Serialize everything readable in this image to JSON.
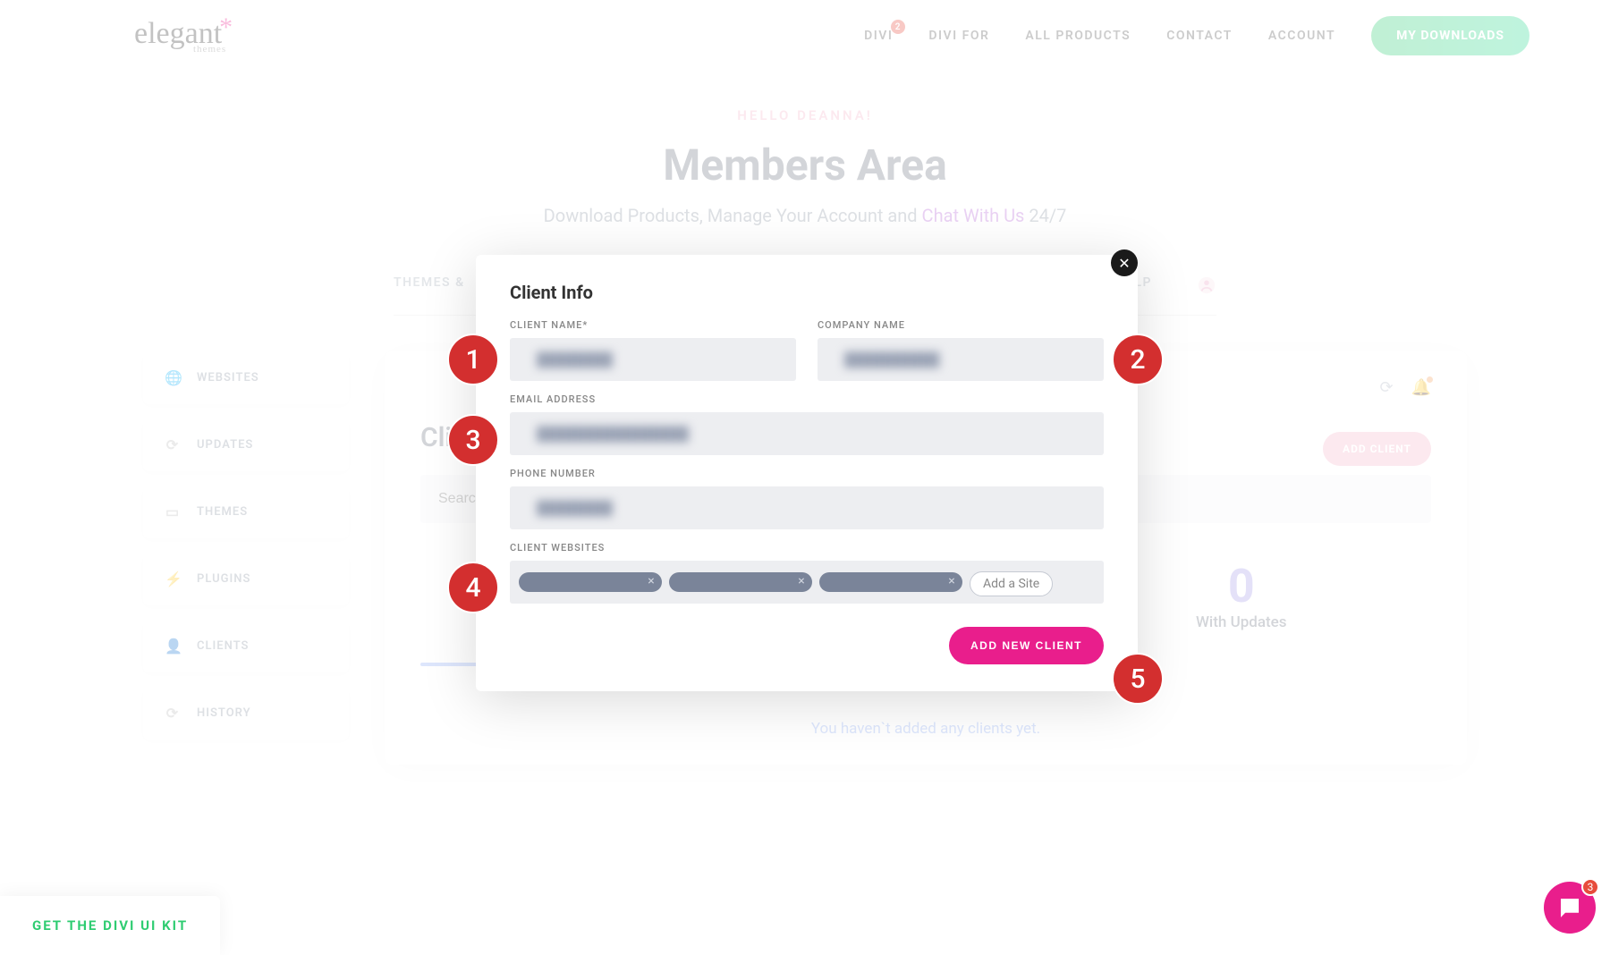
{
  "header": {
    "logo_main": "elegant",
    "logo_sub": "themes",
    "nav": [
      {
        "label": "DIVI",
        "badge": "2"
      },
      {
        "label": "DIVI FOR"
      },
      {
        "label": "ALL PRODUCTS"
      },
      {
        "label": "CONTACT"
      },
      {
        "label": "ACCOUNT"
      }
    ],
    "downloads_btn": "MY DOWNLOADS"
  },
  "hero": {
    "hello": "HELLO DEANNA!",
    "title": "Members Area",
    "subtitle_pre": "Download Products, Manage Your Account and ",
    "subtitle_link": "Chat With Us",
    "subtitle_post": " 24/7"
  },
  "tabs": {
    "themes": "THEMES &",
    "help": "LP"
  },
  "sidebar": {
    "items": [
      {
        "icon": "globe",
        "label": "WEBSITES"
      },
      {
        "icon": "refresh",
        "label": "UPDATES"
      },
      {
        "icon": "card",
        "label": "THEMES"
      },
      {
        "icon": "plug",
        "label": "PLUGINS"
      },
      {
        "icon": "user",
        "label": "CLIENTS"
      },
      {
        "icon": "refresh",
        "label": "HISTORY"
      }
    ]
  },
  "dashboard": {
    "title": "Clie",
    "add_client_btn": "ADD CLIENT",
    "search_placeholder": "Search",
    "stat_num": "0",
    "stat_label": "With Updates",
    "empty": "You haven`t added any clients yet."
  },
  "modal": {
    "title": "Client Info",
    "labels": {
      "client_name": "CLIENT NAME",
      "company": "COMPANY NAME",
      "email": "EMAIL ADDRESS",
      "phone": "PHONE NUMBER",
      "websites": "CLIENT WEBSITES"
    },
    "add_site": "Add a Site",
    "submit": "ADD NEW CLIENT"
  },
  "ui_kit": "GET THE DIVI UI KIT",
  "chat_badge": "3",
  "annotations": [
    "1",
    "2",
    "3",
    "4",
    "5"
  ]
}
